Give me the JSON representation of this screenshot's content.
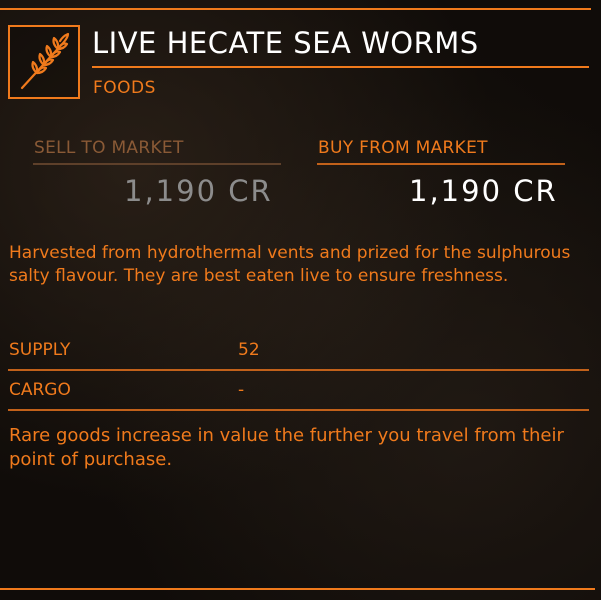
{
  "item": {
    "title": "LIVE HECATE SEA WORMS",
    "category": "FOODS",
    "icon": "wheat-icon"
  },
  "market": {
    "sell_label": "SELL TO MARKET",
    "sell_price": "1,190 CR",
    "buy_label": "BUY FROM MARKET",
    "buy_price": "1,190 CR"
  },
  "description": "Harvested from hydrothermal vents and prized for the sulphurous salty flavour. They are best eaten live to ensure freshness.",
  "stats": {
    "supply_label": "SUPPLY",
    "supply_value": "52",
    "cargo_label": "CARGO",
    "cargo_value": "-"
  },
  "note": "Rare goods increase in value the further you travel from their point of purchase.",
  "colors": {
    "accent": "#f07a1c",
    "dim_accent": "#8a5a36",
    "highlight_text": "#ffffff",
    "disabled_price": "#8c8c8c"
  }
}
